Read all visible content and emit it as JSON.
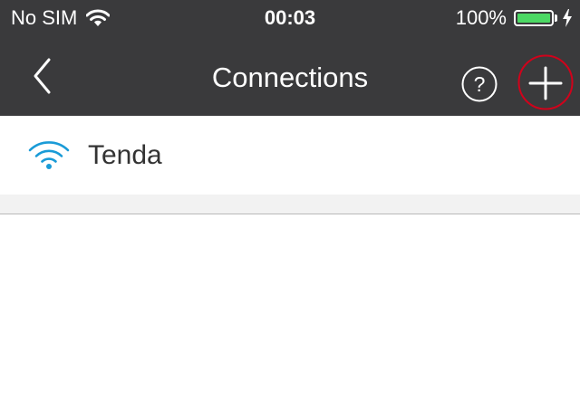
{
  "status_bar": {
    "carrier": "No SIM",
    "time": "00:03",
    "battery_percent": "100%",
    "battery_level": 1.0,
    "battery_color": "#4cd964",
    "wifi_icon": "wifi-icon",
    "charging_icon": "bolt-icon"
  },
  "nav_bar": {
    "title": "Connections",
    "back_icon": "chevron-left-icon",
    "help_icon": "question-circle-icon",
    "add_icon": "plus-icon",
    "add_highlight_color": "#d0021b"
  },
  "connections": [
    {
      "name": "Tenda",
      "icon": "wifi-icon",
      "icon_color": "#1a9bd7"
    }
  ]
}
